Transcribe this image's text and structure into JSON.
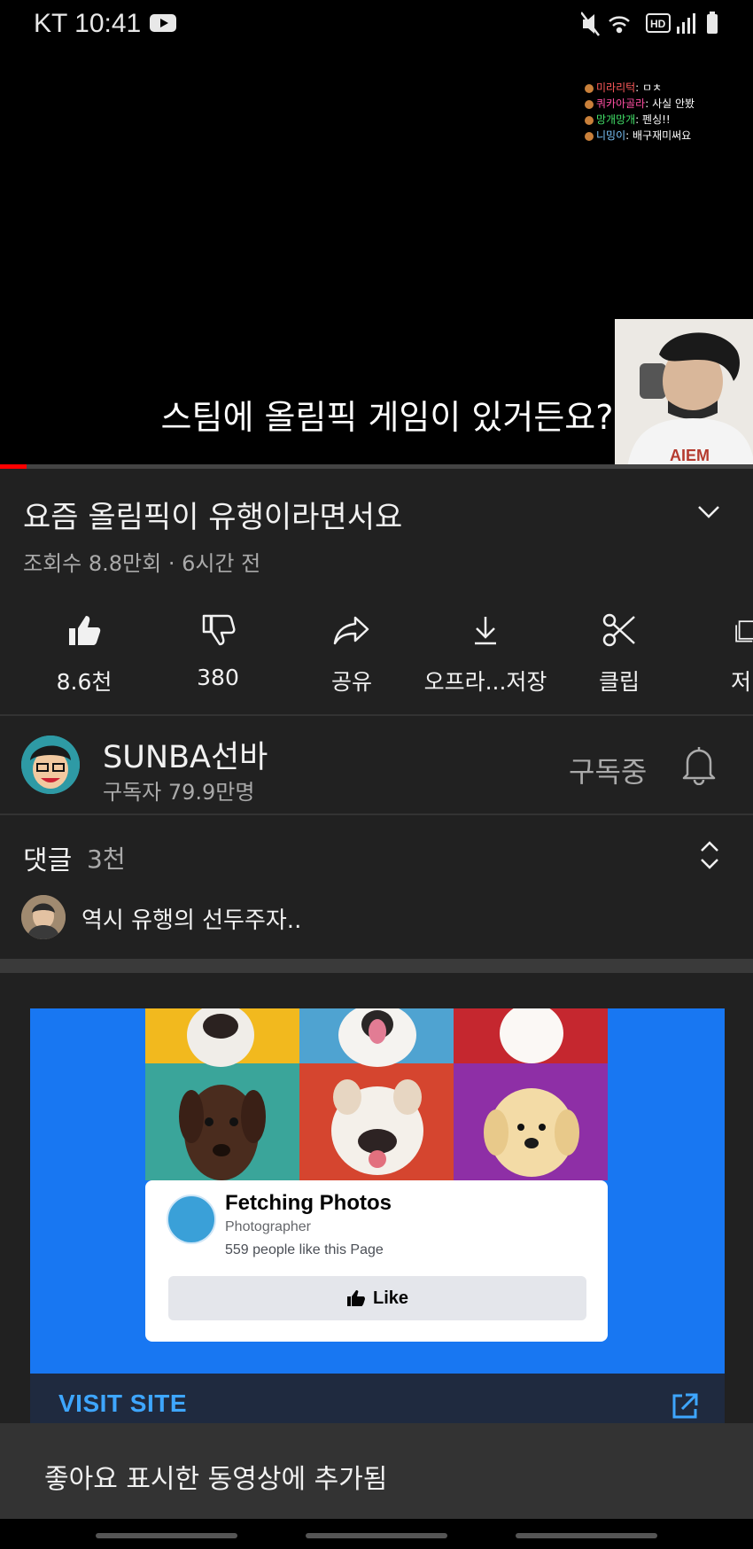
{
  "status_bar": {
    "carrier_time": "KT 10:41",
    "icons": [
      "mute-icon",
      "wifi-icon",
      "hd-voice-icon",
      "signal-icon",
      "battery-icon"
    ]
  },
  "video": {
    "subtitle": "스팀에 올림픽 게임이 있거든요?",
    "chat": [
      {
        "user": "미라리턱",
        "message": "ㅁㅊ"
      },
      {
        "user": "쿼카아골라",
        "message": "사실 안봤"
      },
      {
        "user": "망개망개",
        "message": "펜싱!!"
      },
      {
        "user": "니밍이",
        "message": "배구재미써요"
      }
    ],
    "progress": 0.035
  },
  "info": {
    "title": "요즘 올림픽이 유행이라면서요",
    "meta": "조회수 8.8만회 · 6시간 전"
  },
  "actions": [
    {
      "icon": "thumbs-up-icon",
      "label": "8.6천"
    },
    {
      "icon": "thumbs-down-icon",
      "label": "380"
    },
    {
      "icon": "share-icon",
      "label": "공유"
    },
    {
      "icon": "download-icon",
      "label": "오프라...저장"
    },
    {
      "icon": "scissors-icon",
      "label": "클립"
    },
    {
      "icon": "save-playlist-icon",
      "label": "저"
    }
  ],
  "channel": {
    "name": "SUNBA선바",
    "subscribers": "구독자 79.9만명",
    "subscribe_state": "구독중"
  },
  "comments": {
    "label": "댓글",
    "count": "3천",
    "top_comment": "역시 유행의 선두주자.."
  },
  "ad": {
    "page_name": "Fetching Photos",
    "page_category": "Photographer",
    "page_likes": "559 people like this Page",
    "like_label": "Like",
    "cta": "VISIT SITE",
    "background": "#1877f2"
  },
  "toast": {
    "text": "좋아요 표시한 동영상에 추가됨"
  }
}
